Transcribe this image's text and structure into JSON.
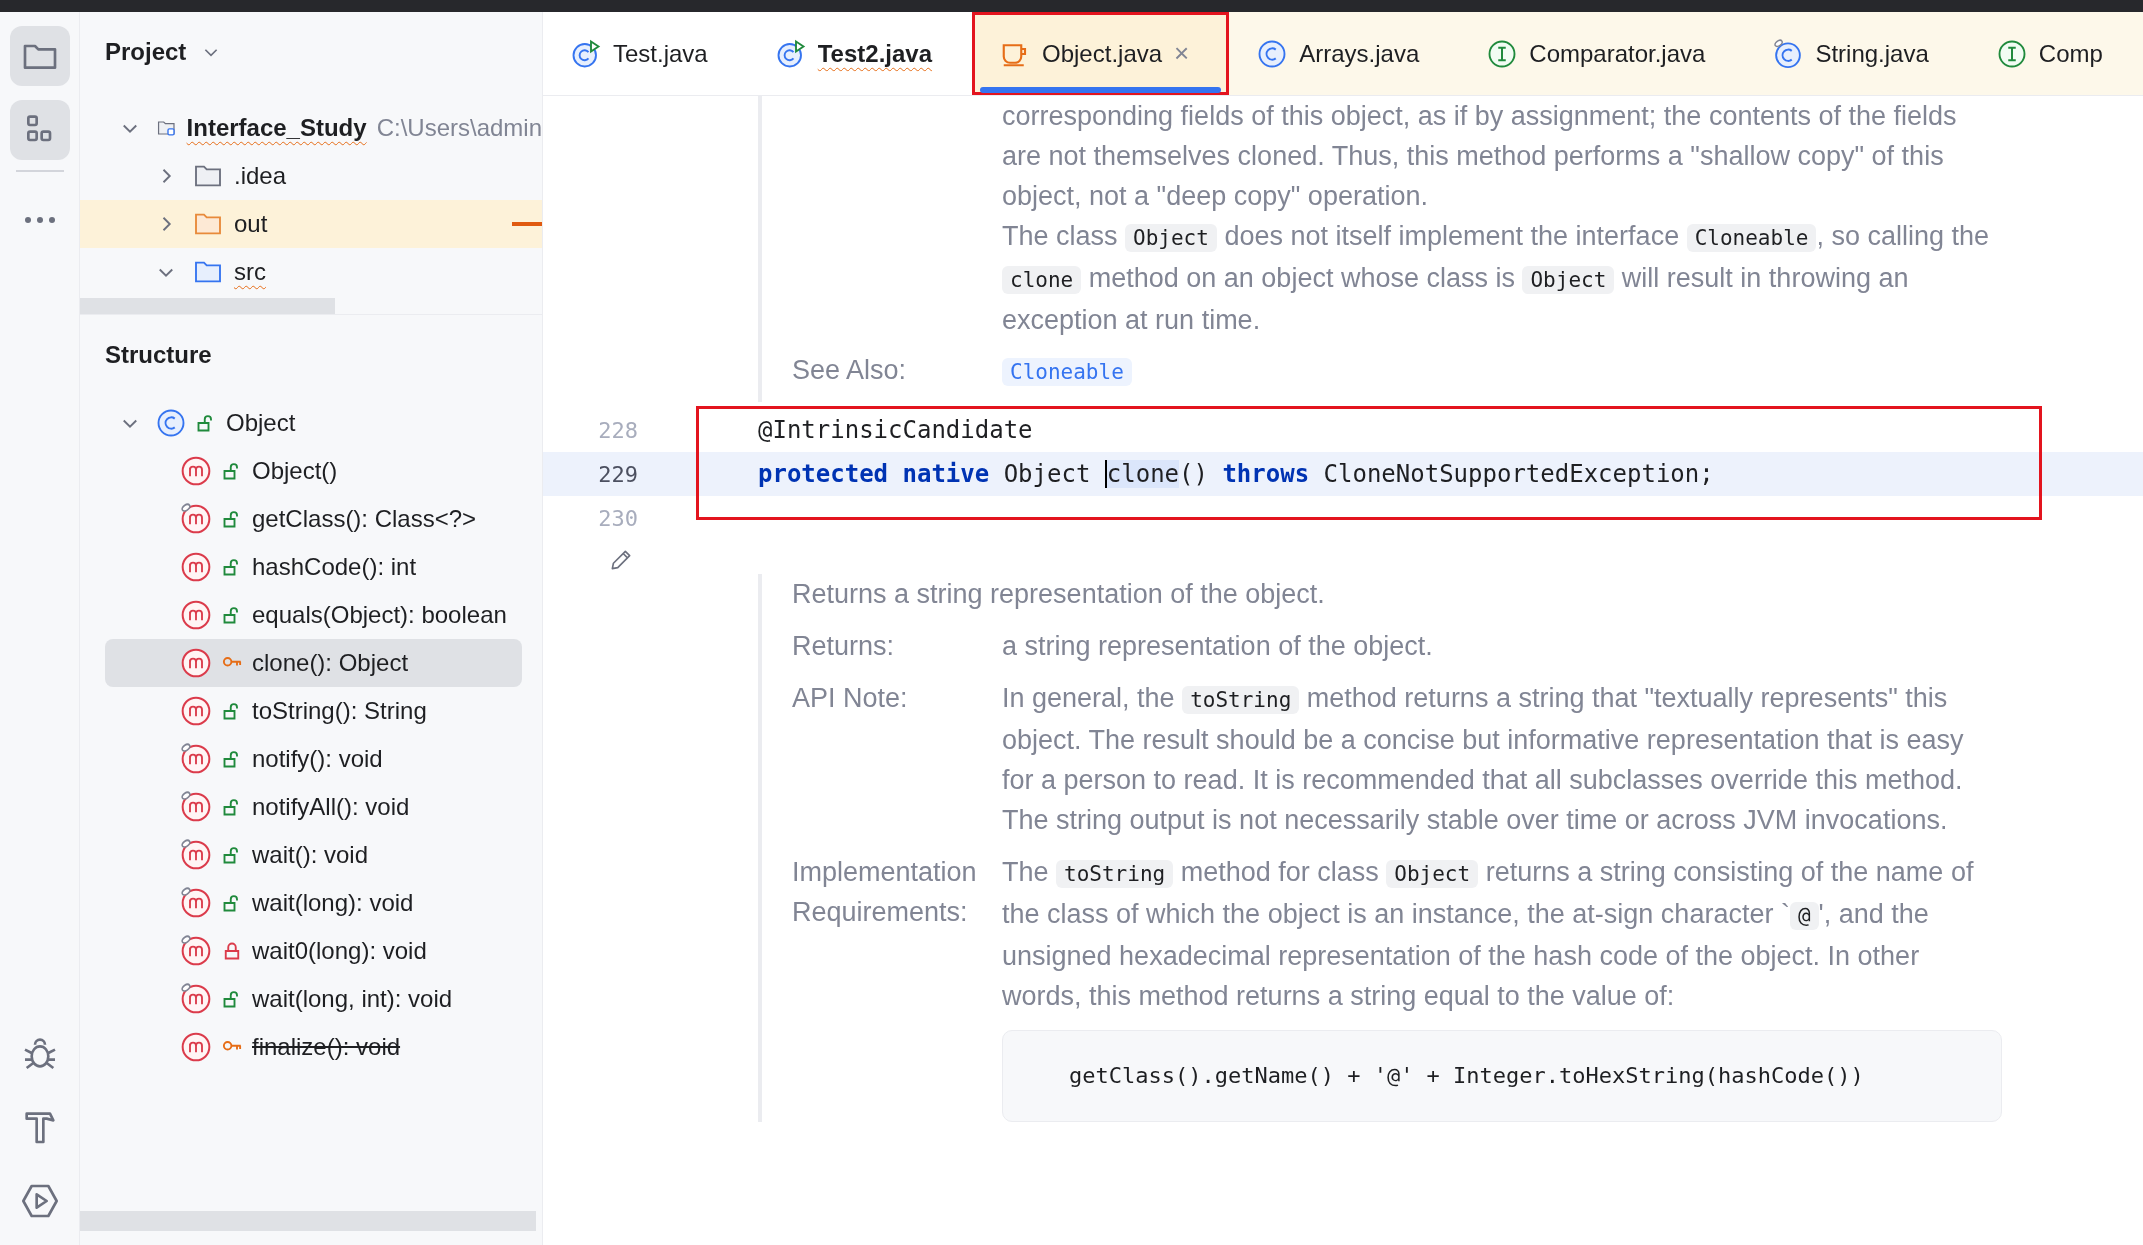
{
  "toolbar": [
    {
      "kind": "folder",
      "selected": true
    },
    {
      "kind": "structure",
      "selected": true
    },
    {
      "kind": "more",
      "selected": false
    },
    {
      "kind": "bug",
      "selected": false
    },
    {
      "kind": "hammer",
      "selected": false
    },
    {
      "kind": "run",
      "selected": false
    }
  ],
  "project": {
    "title": "Project",
    "tree": [
      {
        "label": "Interface_Study",
        "path": "C:\\Users\\admin",
        "kind": "module",
        "expanded": true,
        "error": true,
        "highlighted": false,
        "children": [
          {
            "label": ".idea",
            "kind": "folder",
            "expanded": false,
            "error": false,
            "highlighted": false
          },
          {
            "label": "out",
            "kind": "excluded",
            "expanded": false,
            "error": false,
            "highlighted": true
          },
          {
            "label": "src",
            "kind": "source",
            "expanded": true,
            "error": true,
            "highlighted": false
          }
        ]
      }
    ]
  },
  "structure": {
    "title": "Structure",
    "root": {
      "label": "Object",
      "kind": "class",
      "expanded": true,
      "children": [
        {
          "label": "Object()",
          "kind": "public",
          "final": false,
          "deprecated": false,
          "selected": false
        },
        {
          "label": "getClass(): Class<?>",
          "kind": "public",
          "final": true,
          "deprecated": false,
          "selected": false
        },
        {
          "label": "hashCode(): int",
          "kind": "public",
          "final": false,
          "deprecated": false,
          "selected": false
        },
        {
          "label": "equals(Object): boolean",
          "kind": "public",
          "final": false,
          "deprecated": false,
          "selected": false
        },
        {
          "label": "clone(): Object",
          "kind": "protected",
          "final": false,
          "deprecated": false,
          "selected": true
        },
        {
          "label": "toString(): String",
          "kind": "public",
          "final": false,
          "deprecated": false,
          "selected": false
        },
        {
          "label": "notify(): void",
          "kind": "public",
          "final": true,
          "deprecated": false,
          "selected": false
        },
        {
          "label": "notifyAll(): void",
          "kind": "public",
          "final": true,
          "deprecated": false,
          "selected": false
        },
        {
          "label": "wait(): void",
          "kind": "public",
          "final": true,
          "deprecated": false,
          "selected": false
        },
        {
          "label": "wait(long): void",
          "kind": "public",
          "final": true,
          "deprecated": false,
          "selected": false
        },
        {
          "label": "wait0(long): void",
          "kind": "private",
          "final": true,
          "deprecated": false,
          "selected": false
        },
        {
          "label": "wait(long, int): void",
          "kind": "public",
          "final": true,
          "deprecated": false,
          "selected": false
        },
        {
          "label": "finalize(): void",
          "kind": "protected",
          "final": false,
          "deprecated": true,
          "selected": false
        }
      ]
    }
  },
  "tabs": [
    {
      "label": "Test.java",
      "kind": "runnable",
      "selected": false,
      "library": false,
      "error": false,
      "highlighted": false
    },
    {
      "label": "Test2.java",
      "kind": "runnable",
      "selected": false,
      "library": false,
      "error": true,
      "highlighted": false
    },
    {
      "label": "Object.java",
      "kind": "source",
      "selected": true,
      "library": true,
      "error": false,
      "highlighted": true,
      "close": "×"
    },
    {
      "label": "Arrays.java",
      "kind": "class",
      "selected": false,
      "library": true,
      "error": false,
      "highlighted": false
    },
    {
      "label": "Comparator.java",
      "kind": "interface",
      "selected": false,
      "library": true,
      "error": false,
      "highlighted": false
    },
    {
      "label": "String.java",
      "kind": "final-class",
      "selected": false,
      "library": true,
      "error": false,
      "highlighted": false
    },
    {
      "label": "Comp",
      "kind": "interface",
      "selected": false,
      "library": true,
      "error": false,
      "highlighted": false
    }
  ],
  "doc_top": {
    "paragraphs": [
      [
        {
          "kind": "text",
          "text": "corresponding fields of this object, as if by assignment; the contents of the fields are not themselves cloned. Thus, this method performs a \"shallow copy\" of this object, not a \"deep copy\" operation."
        }
      ],
      [
        {
          "kind": "text",
          "text": "The class "
        },
        {
          "kind": "code",
          "text": "Object"
        },
        {
          "kind": "text",
          "text": " does not itself implement the interface "
        },
        {
          "kind": "code",
          "text": "Cloneable"
        },
        {
          "kind": "text",
          "text": ", so calling the "
        },
        {
          "kind": "code",
          "text": "clone"
        },
        {
          "kind": "text",
          "text": " method on an object whose class is "
        },
        {
          "kind": "code",
          "text": "Object"
        },
        {
          "kind": "text",
          "text": " will result in throwing an exception at run time."
        }
      ]
    ],
    "see_also": {
      "label": "See Also:",
      "link": "Cloneable"
    }
  },
  "code": {
    "highlighted": true,
    "lines": [
      {
        "number": "228",
        "current": false,
        "tokens": [
          {
            "kind": "annotation",
            "text": "@IntrinsicCandidate",
            "caret": false
          }
        ]
      },
      {
        "number": "229",
        "current": true,
        "tokens": [
          {
            "kind": "keyword",
            "text": "protected native",
            "caret": false
          },
          {
            "kind": "plain",
            "text": " Object ",
            "caret": false
          },
          {
            "kind": "usage",
            "text": "clone",
            "caret": true
          },
          {
            "kind": "plain",
            "text": "() ",
            "caret": false
          },
          {
            "kind": "keyword",
            "text": "throws",
            "caret": false
          },
          {
            "kind": "plain",
            "text": " CloneNotSupportedException;",
            "caret": false
          }
        ]
      },
      {
        "number": "230",
        "current": false
      }
    ]
  },
  "doc_bottom": {
    "summary": "Returns a string representation of the object.",
    "rows": [
      {
        "label": "Returns:",
        "segments": [
          {
            "kind": "text",
            "text": "a string representation of the object."
          }
        ]
      },
      {
        "label": "API Note:",
        "segments": [
          {
            "kind": "text",
            "text": "In general, the "
          },
          {
            "kind": "code",
            "text": "toString"
          },
          {
            "kind": "text",
            "text": " method returns a string that \"textually represents\" this object. The result should be a concise but informative representation that is easy for a person to read. It is recommended that all subclasses override this method. The string output is not necessarily stable over time or across JVM invocations."
          }
        ]
      },
      {
        "label": "Implementation Requirements:",
        "segments": [
          {
            "kind": "text",
            "text": "The "
          },
          {
            "kind": "code",
            "text": "toString"
          },
          {
            "kind": "text",
            "text": " method for class "
          },
          {
            "kind": "code",
            "text": "Object"
          },
          {
            "kind": "text",
            "text": " returns a string consisting of the name of the class of which the object is an instance, the at-sign character `"
          },
          {
            "kind": "code",
            "text": "@"
          },
          {
            "kind": "text",
            "text": "', and the unsigned hexadecimal representation of the hash code of the object. In other words, this method returns a string equal to the value of:"
          }
        ]
      }
    ],
    "code_block": "getClass().getName() + '@' + Integer.toHexString(hashCode())"
  }
}
